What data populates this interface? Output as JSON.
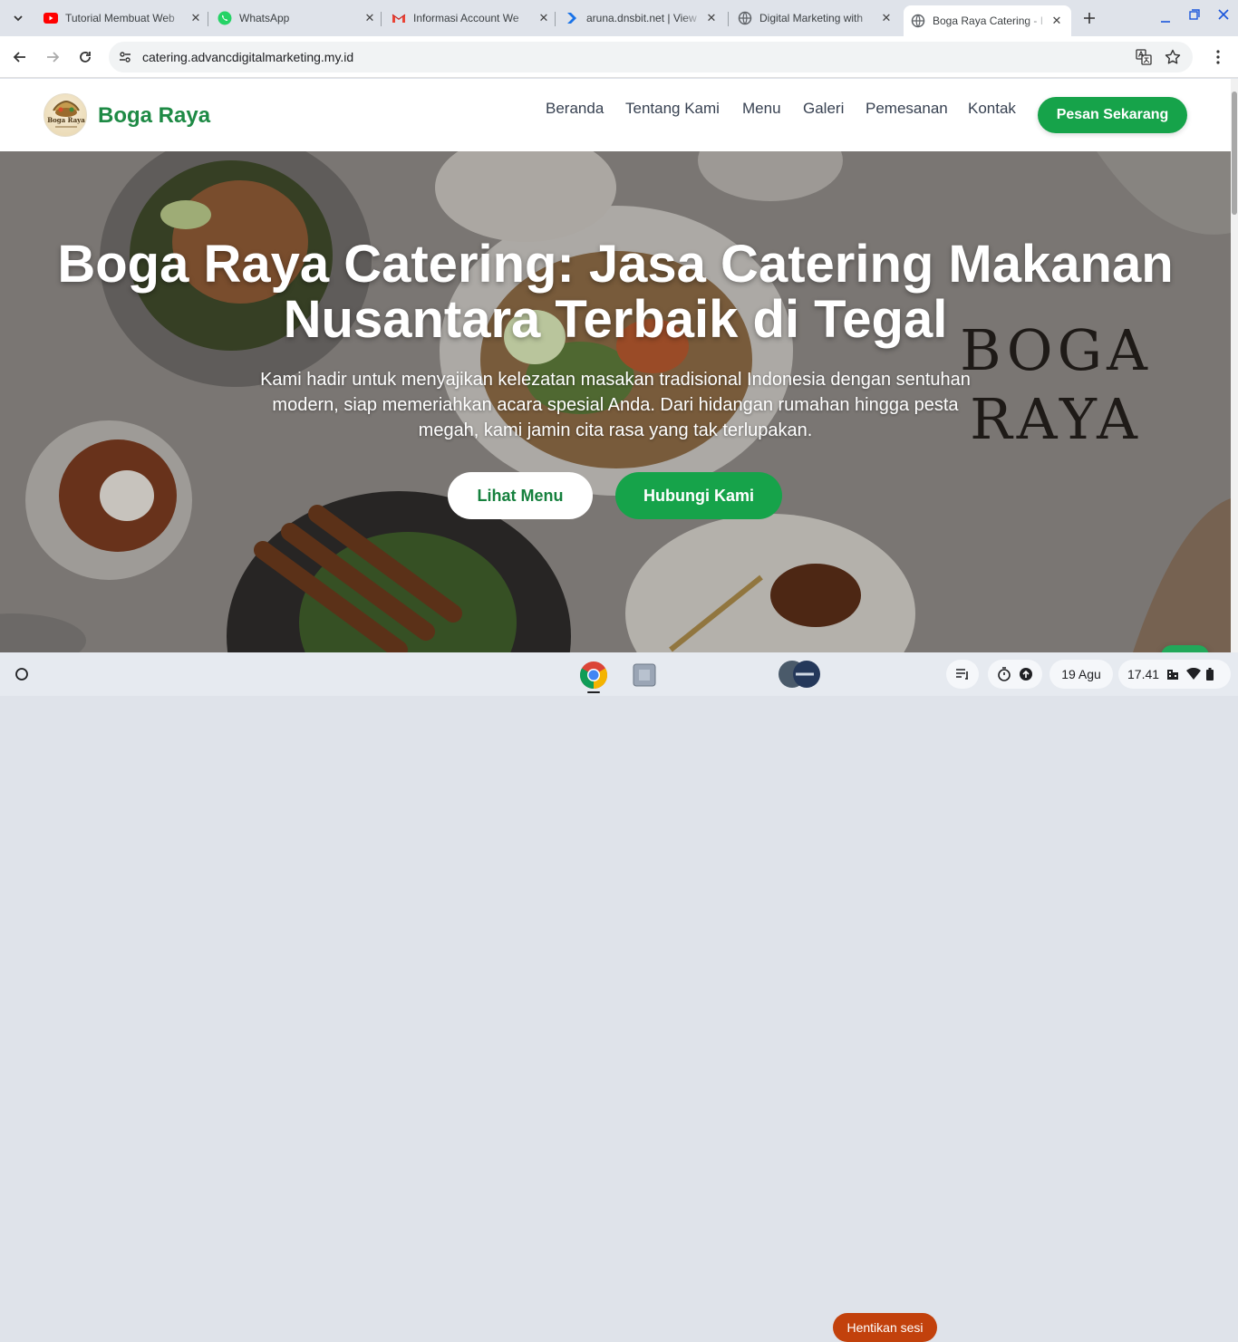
{
  "browser": {
    "tabs": [
      {
        "title": "Tutorial Membuat Web",
        "icon": "youtube-icon"
      },
      {
        "title": "WhatsApp",
        "icon": "whatsapp-icon"
      },
      {
        "title": "Informasi Account We",
        "icon": "gmail-icon"
      },
      {
        "title": "aruna.dnsbit.net | View",
        "icon": "aruna-icon"
      },
      {
        "title": "Digital Marketing with",
        "icon": "globe-icon"
      },
      {
        "title": "Boga Raya Catering - I",
        "icon": "globe-icon"
      }
    ],
    "url": "catering.advancdigitalmarketing.my.id"
  },
  "site": {
    "brand": "Boga Raya",
    "logo_text": "Boga Raya",
    "nav": [
      "Beranda",
      "Tentang Kami",
      "Menu",
      "Galeri",
      "Pemesanan",
      "Kontak"
    ],
    "cta": "Pesan Sekarang",
    "hero": {
      "title_line1": "Boga Raya Catering: Jasa Catering Makanan",
      "title_line2": "Nusantara Terbaik di Tegal",
      "subtitle": "Kami hadir untuk menyajikan kelezatan masakan tradisional Indonesia dengan sentuhan modern, siap memeriahkan acara spesial Anda. Dari hidangan rumahan hingga pesta megah, kami jamin cita rasa yang tak terlupakan.",
      "watermark_line1": "BOGA",
      "watermark_line2": "RAYA",
      "btn_menu": "Lihat Menu",
      "btn_contact": "Hubungi Kami"
    }
  },
  "shelf": {
    "stop_session": "Hentikan sesi",
    "date": "19 Agu",
    "time": "17.41"
  },
  "colors": {
    "brand_green": "#16a34a",
    "brand_text": "#1e8a45",
    "stop_button": "#c2410c"
  }
}
